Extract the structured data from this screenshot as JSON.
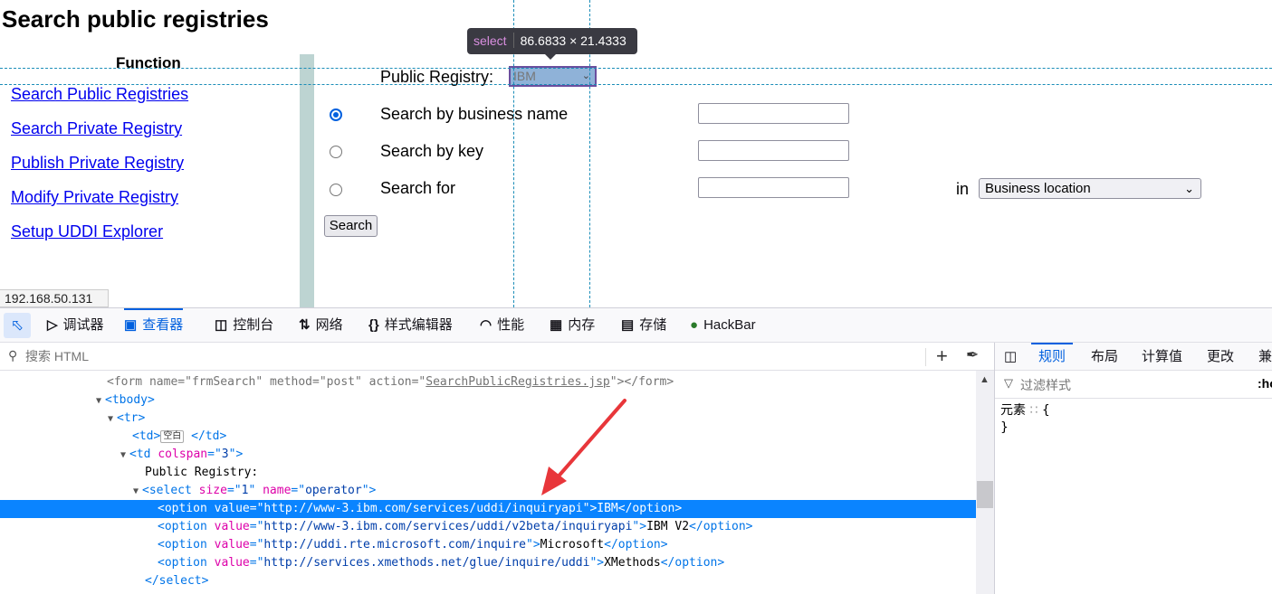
{
  "page": {
    "title": "Search public registries",
    "function_heading": "Function",
    "nav": [
      {
        "label": "Search Public Registries"
      },
      {
        "label": "Search Private Registry"
      },
      {
        "label": "Publish Private Registry"
      },
      {
        "label": "Modify Private Registry"
      },
      {
        "label": "Setup UDDI Explorer"
      }
    ],
    "form": {
      "registry_label": "Public Registry:",
      "registry_selected": "IBM",
      "options": [
        {
          "label": "Search by business name",
          "checked": true
        },
        {
          "label": "Search by key",
          "checked": false
        },
        {
          "label": "Search for",
          "checked": false
        }
      ],
      "in_label": "in",
      "location_selected": "Business location",
      "search_button": "Search"
    },
    "status_url": "192.168.50.131"
  },
  "inspector_tooltip": {
    "tag": "select",
    "size": "86.6833 × 21.4333"
  },
  "devtools": {
    "tools": [
      {
        "label": "调试器",
        "icon": "debugger-icon"
      },
      {
        "label": "查看器",
        "icon": "inspector-icon",
        "active": true
      },
      {
        "label": "控制台",
        "icon": "console-icon"
      },
      {
        "label": "网络",
        "icon": "network-icon"
      },
      {
        "label": "样式编辑器",
        "icon": "style-editor-icon"
      },
      {
        "label": "性能",
        "icon": "performance-icon"
      },
      {
        "label": "内存",
        "icon": "memory-icon"
      },
      {
        "label": "存储",
        "icon": "storage-icon"
      },
      {
        "label": "HackBar",
        "icon": "hackbar-icon"
      }
    ],
    "search_placeholder": "搜索 HTML",
    "right_tabs": [
      {
        "label": "规则",
        "active": true
      },
      {
        "label": "布局"
      },
      {
        "label": "计算值"
      },
      {
        "label": "更改"
      },
      {
        "label": "兼"
      }
    ],
    "filter_placeholder": "过滤样式",
    "hov_label": ":ho",
    "rule": {
      "selector": "元素",
      "open": "{",
      "close": "}"
    },
    "html": {
      "form_line": {
        "name": "frmSearch",
        "method": "post",
        "action": "SearchPublicRegistries.jsp"
      },
      "tbody": "tbody",
      "tr": "tr",
      "td_empty_badge": "空白",
      "td_colspan": "3",
      "text_public_registry": "Public Registry:",
      "select_size": "1",
      "select_name": "operator",
      "options": [
        {
          "value": "http://www-3.ibm.com/services/uddi/inquiryapi",
          "text": "IBM"
        },
        {
          "value": "http://www-3.ibm.com/services/uddi/v2beta/inquiryapi",
          "text": "IBM V2"
        },
        {
          "value": "http://uddi.rte.microsoft.com/inquire",
          "text": "Microsoft"
        },
        {
          "value": "http://services.xmethods.net/glue/inquire/uddi",
          "text": "XMethods"
        }
      ]
    }
  },
  "colors": {
    "link": "#0000ee",
    "accent": "#0060df",
    "selection": "#0a84ff",
    "annotation_arrow": "#e8363a"
  }
}
